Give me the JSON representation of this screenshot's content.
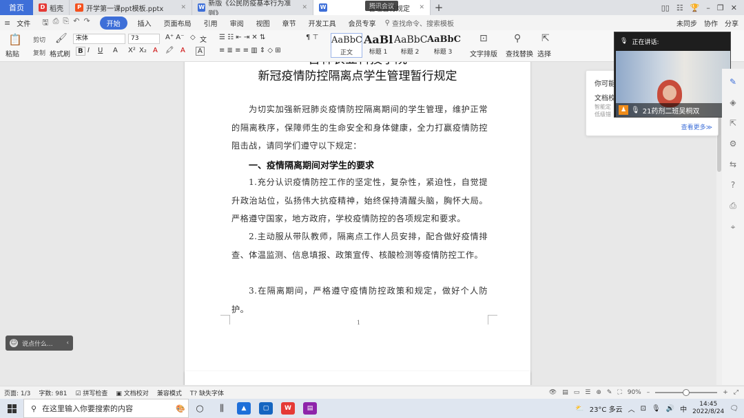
{
  "tabs": {
    "home": "首页",
    "items": [
      {
        "label": "稻壳",
        "icon_color": "#e53935"
      },
      {
        "label": "开学第一课ppt模板.pptx",
        "icon_color": "#f4511e"
      },
      {
        "label": "新版《公民防疫基本行为准则》",
        "icon_color": "#3e6fd8"
      },
      {
        "label": "管理暂行规定",
        "icon_color": "#3e6fd8"
      }
    ],
    "add": "+",
    "overlay_badge": "腾讯会议",
    "right_icons": [
      "▯▯",
      "☷",
      "🏆",
      "–",
      "❐",
      "✕"
    ]
  },
  "menubar": {
    "file": "文件",
    "start": "开始",
    "items": [
      "插入",
      "页面布局",
      "引用",
      "审阅",
      "视图",
      "章节",
      "开发工具",
      "会员专享"
    ],
    "search": "查找命令、搜索模板",
    "right": [
      "未同步",
      "协作",
      "分享"
    ]
  },
  "ribbon": {
    "paste": "粘贴",
    "cut": "剪切",
    "copy": "复制",
    "format_painter": "格式刷",
    "font_name": "宋体",
    "font_size": "73",
    "styles": [
      {
        "sample": "AaBbC",
        "name": "正文"
      },
      {
        "sample": "AaBl",
        "name": "标题 1"
      },
      {
        "sample": "AaBbC",
        "name": "标题 2"
      },
      {
        "sample": "AaBbC",
        "name": "标题 3"
      }
    ],
    "text_layout": "文字排版",
    "find_replace": "查找替换",
    "select": "选择"
  },
  "document": {
    "title_line1": "吉林农业科技学院",
    "title_line2": "新冠疫情防控隔离点学生管理暂行规定",
    "intro": "为切实加强新冠肺炎疫情防控隔离期间的学生管理，维护正常的隔离秩序，保障师生的生命安全和身体健康，全力打赢疫情防控阻击战，请同学们遵守以下规定：",
    "heading1": "一、疫情隔离期间对学生的要求",
    "item1": "1.充分认识疫情防控工作的坚定性，复杂性，紧迫性，自觉提升政治站位，弘扬伟大抗疫精神，始终保持清醒头脑，胸怀大局。严格遵守国家，地方政府，学校疫情防控的各项规定和要求。",
    "item2": "2.主动服从带队教师，隔离点工作人员安排，配合做好疫情排查、体温监测、信息填报、政策宣传、核酸检测等疫情防控工作。",
    "item3": "3.在隔离期间，严格遵守疫情防控政策和规定，做好个人防护。",
    "page_number": "1"
  },
  "suggest_panel": {
    "line1": "你可能",
    "line2": "文档校",
    "line3a": "智能定",
    "line3b": "低级错",
    "more": "查看更多≫"
  },
  "video": {
    "header": "正在讲话:",
    "name": "21药剂二班吴桐双"
  },
  "chat": {
    "placeholder": "说点什么..."
  },
  "statusbar": {
    "page": "页面: 1/3",
    "words": "字数: 981",
    "spell": "拼写检查",
    "proofread": "文档校对",
    "compat": "兼容模式",
    "missing_font": "缺失字体",
    "zoom": "90%"
  },
  "taskbar": {
    "search_placeholder": "在这里输入你要搜索的内容",
    "weather": "23°C 多云",
    "ime": "中",
    "time": "14:45",
    "date": "2022/8/24"
  }
}
